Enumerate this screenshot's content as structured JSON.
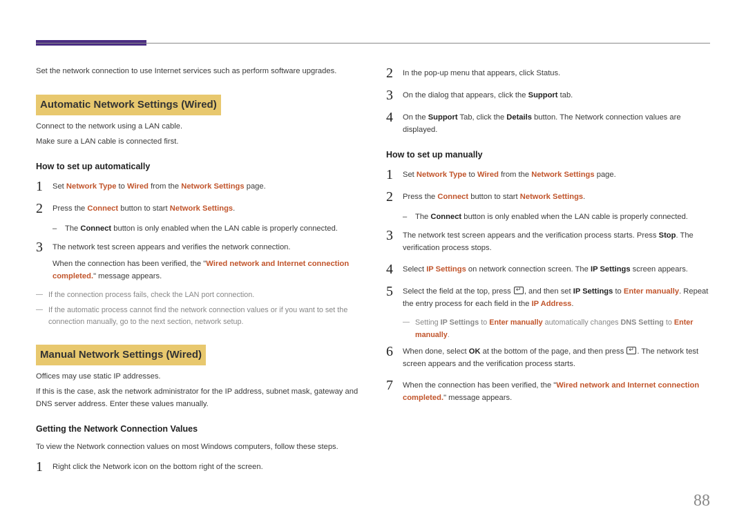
{
  "page_number": "88",
  "left": {
    "intro": "Set the network connection to use Internet services such as perform software upgrades.",
    "heading_auto": "Automatic Network Settings (Wired)",
    "auto_desc1": "Connect to the network using a LAN cable.",
    "auto_desc2": "Make sure a LAN cable is connected first.",
    "subhead_auto": "How to set up automatically",
    "auto_step1_a": "Set ",
    "auto_step1_b": "Network Type",
    "auto_step1_c": " to ",
    "auto_step1_d": "Wired",
    "auto_step1_e": " from the ",
    "auto_step1_f": "Network Settings",
    "auto_step1_g": " page.",
    "auto_step2_a": "Press the ",
    "auto_step2_b": "Connect",
    "auto_step2_c": " button to start ",
    "auto_step2_d": "Network Settings",
    "auto_step2_e": ".",
    "auto_dash_a": "The ",
    "auto_dash_b": "Connect",
    "auto_dash_c": " button is only enabled when the LAN cable is properly connected.",
    "auto_step3_a": "The network test screen appears and verifies the network connection.",
    "auto_step3_b": "When the connection has been verified, the \"",
    "auto_step3_c": "Wired network and Internet connection completed.",
    "auto_step3_d": "\" message appears.",
    "auto_note1": "If the connection process fails, check the LAN port connection.",
    "auto_note2": "If the automatic process cannot find the network connection values or if you want to set the connection manually, go to the next section, network setup.",
    "heading_manual": "Manual Network Settings (Wired)",
    "manual_desc1": "Offices may use static IP addresses.",
    "manual_desc2": "If this is the case, ask the network administrator for the IP address, subnet mask, gateway and DNS server address. Enter these values manually.",
    "subhead_values": "Getting the Network Connection Values",
    "values_desc": "To view the Network connection values on most Windows computers, follow these steps.",
    "values_step1": "Right click the Network icon on the bottom right of the screen."
  },
  "right": {
    "step2": "In the pop-up menu that appears, click Status.",
    "step3_a": "On the dialog that appears, click the ",
    "step3_b": "Support",
    "step3_c": " tab.",
    "step4_a": "On the ",
    "step4_b": "Support",
    "step4_c": " Tab, click the ",
    "step4_d": "Details",
    "step4_e": " button. The Network connection values are displayed.",
    "subhead_manual": "How to set up manually",
    "m_step1_a": "Set ",
    "m_step1_b": "Network Type",
    "m_step1_c": " to ",
    "m_step1_d": "Wired",
    "m_step1_e": " from the ",
    "m_step1_f": "Network Settings",
    "m_step1_g": " page.",
    "m_step2_a": "Press the ",
    "m_step2_b": "Connect",
    "m_step2_c": " button to start ",
    "m_step2_d": "Network Settings",
    "m_step2_e": ".",
    "m_dash_a": "The ",
    "m_dash_b": "Connect",
    "m_dash_c": " button is only enabled when the LAN cable is properly connected.",
    "m_step3_a": "The network test screen appears and the verification process starts. Press ",
    "m_step3_b": "Stop",
    "m_step3_c": ". The verification process stops.",
    "m_step4_a": "Select ",
    "m_step4_b": "IP Settings",
    "m_step4_c": " on network connection screen. The ",
    "m_step4_d": "IP Settings",
    "m_step4_e": " screen appears.",
    "m_step5_a": "Select the field at the top, press ",
    "m_step5_b": ", and then set ",
    "m_step5_c": "IP Settings",
    "m_step5_d": " to ",
    "m_step5_e": "Enter manually",
    "m_step5_f": ". Repeat the entry process for each field in the ",
    "m_step5_g": "IP Address",
    "m_step5_h": ".",
    "m_note_a": "Setting ",
    "m_note_b": "IP Settings",
    "m_note_c": " to ",
    "m_note_d": "Enter manually",
    "m_note_e": " automatically changes ",
    "m_note_f": "DNS Setting",
    "m_note_g": " to ",
    "m_note_h": "Enter manually",
    "m_note_i": ".",
    "m_step6_a": "When done, select ",
    "m_step6_b": "OK",
    "m_step6_c": " at the bottom of the page, and then press ",
    "m_step6_d": ". The network test screen appears and the verification process starts.",
    "m_step7_a": "When the connection has been verified, the \"",
    "m_step7_b": "Wired network and Internet connection completed.",
    "m_step7_c": "\" message appears."
  }
}
